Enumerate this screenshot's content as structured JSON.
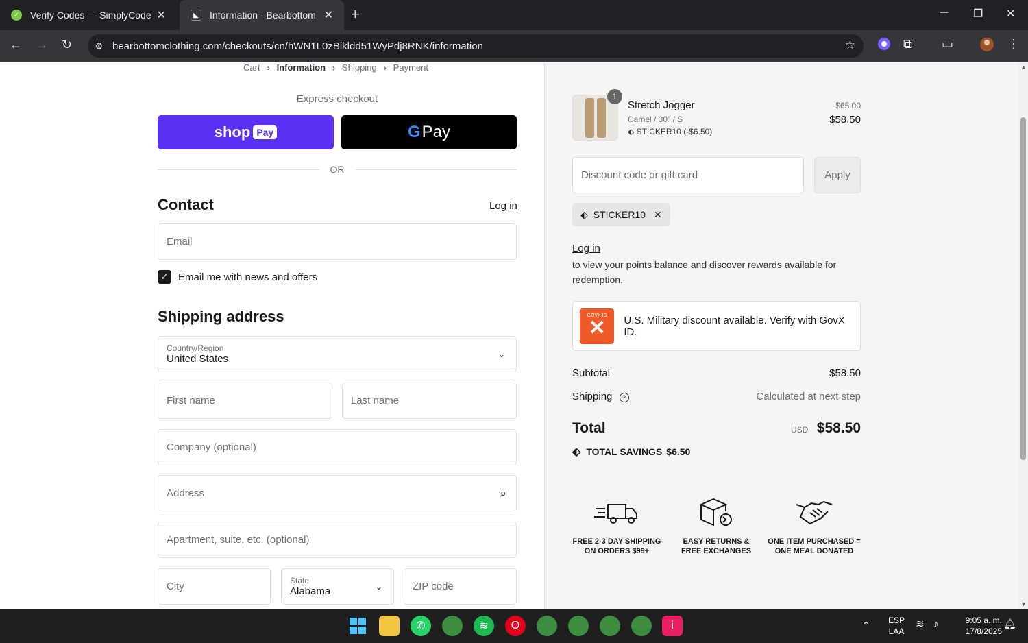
{
  "browser": {
    "tabs": [
      {
        "title": "Verify Codes — SimplyCodes",
        "active": false
      },
      {
        "title": "Information - Bearbottom Cloth",
        "active": true
      }
    ],
    "url": "bearbottomclothing.com/checkouts/cn/hWN1L0zBikldd51WyPdj8RNK/information"
  },
  "breadcrumb": [
    "Cart",
    "Information",
    "Shipping",
    "Payment"
  ],
  "express": {
    "label": "Express checkout",
    "shop_pay": "shop",
    "shop_pay_badge": "Pay",
    "gpay": "Pay",
    "or": "OR"
  },
  "contact": {
    "heading": "Contact",
    "login": "Log in",
    "email_placeholder": "Email",
    "newsletter": "Email me with news and offers"
  },
  "shipping": {
    "heading": "Shipping address",
    "country_label": "Country/Region",
    "country_value": "United States",
    "first_name": "First name",
    "last_name": "Last name",
    "company": "Company (optional)",
    "address": "Address",
    "apartment": "Apartment, suite, etc. (optional)",
    "city": "City",
    "state_label": "State",
    "state_value": "Alabama",
    "zip": "ZIP code"
  },
  "order": {
    "product": {
      "name": "Stretch Jogger",
      "variant": "Camel / 30\" / S",
      "discount": "STICKER10 (-$6.50)",
      "qty": "1",
      "old_price": "$65.00",
      "price": "$58.50"
    },
    "discount_placeholder": "Discount code or gift card",
    "apply": "Apply",
    "applied_code": "STICKER10",
    "rewards_login": "Log in",
    "rewards_text": "to view your points balance and discover rewards available for redemption.",
    "govx_small": "GOVX ID",
    "govx_text": "U.S. Military discount available. Verify with GovX ID.",
    "subtotal_label": "Subtotal",
    "subtotal": "$58.50",
    "shipping_label": "Shipping",
    "shipping_value": "Calculated at next step",
    "total_label": "Total",
    "currency": "USD",
    "total": "$58.50",
    "savings_label": "TOTAL SAVINGS",
    "savings": "$6.50"
  },
  "perks": [
    {
      "line1": "FREE 2-3 DAY SHIPPING",
      "line2": "ON ORDERS $99+"
    },
    {
      "line1": "EASY RETURNS &",
      "line2": "FREE EXCHANGES"
    },
    {
      "line1": "ONE ITEM PURCHASED =",
      "line2": "ONE MEAL DONATED"
    }
  ],
  "taskbar": {
    "lang1": "ESP",
    "lang2": "LAA",
    "time": "9:05 a. m.",
    "date": "17/8/2025"
  },
  "colors": {
    "shop_pay": "#5a31f4",
    "gpay": "#000000",
    "govx": "#f05a28"
  }
}
